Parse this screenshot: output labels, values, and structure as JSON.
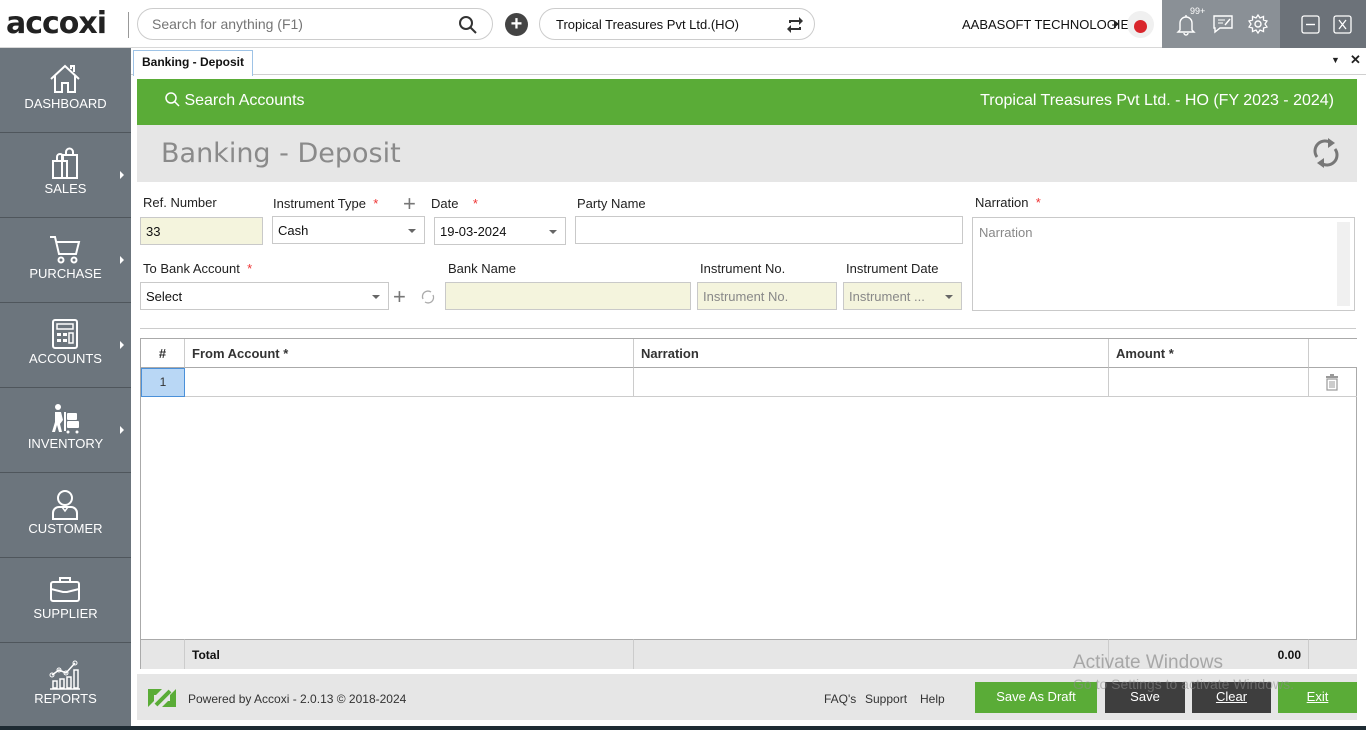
{
  "app": {
    "logo": "accoxi"
  },
  "topbar": {
    "search_placeholder": "Search for anything (F1)",
    "company_selector": "Tropical Treasures Pvt Ltd.(HO)",
    "organization": "AABASOFT TECHNOLOGIES",
    "notification_count": "99+"
  },
  "sidebar": {
    "items": [
      {
        "label": "DASHBOARD",
        "icon": "home-icon",
        "has_submenu": false
      },
      {
        "label": "SALES",
        "icon": "shopping-bag-icon",
        "has_submenu": true
      },
      {
        "label": "PURCHASE",
        "icon": "cart-icon",
        "has_submenu": true
      },
      {
        "label": "ACCOUNTS",
        "icon": "calculator-icon",
        "has_submenu": true
      },
      {
        "label": "INVENTORY",
        "icon": "trolley-icon",
        "has_submenu": true
      },
      {
        "label": "CUSTOMER",
        "icon": "user-icon",
        "has_submenu": false
      },
      {
        "label": "SUPPLIER",
        "icon": "briefcase-icon",
        "has_submenu": false
      },
      {
        "label": "REPORTS",
        "icon": "chart-icon",
        "has_submenu": false
      }
    ]
  },
  "tabs": [
    {
      "label": "Banking - Deposit",
      "active": true
    }
  ],
  "header": {
    "search_accounts": "Search Accounts",
    "company_fy": "Tropical Treasures Pvt Ltd. - HO (FY 2023 - 2024)",
    "page_title": "Banking - Deposit"
  },
  "form": {
    "ref_number": {
      "label": "Ref. Number",
      "value": "33"
    },
    "instrument_type": {
      "label": "Instrument Type",
      "required": "*",
      "value": "Cash"
    },
    "date": {
      "label": "Date",
      "required": "*",
      "value": "19-03-2024"
    },
    "party_name": {
      "label": "Party Name",
      "value": ""
    },
    "narration": {
      "label": "Narration",
      "required": "*",
      "placeholder": "Narration"
    },
    "to_bank_account": {
      "label": "To Bank Account",
      "required": "*",
      "value": "Select"
    },
    "bank_name": {
      "label": "Bank Name",
      "value": ""
    },
    "instrument_no": {
      "label": "Instrument No.",
      "placeholder": "Instrument No."
    },
    "instrument_date": {
      "label": "Instrument Date",
      "placeholder": "Instrument ..."
    }
  },
  "grid": {
    "columns": [
      "#",
      "From Account *",
      "Narration",
      "Amount *"
    ],
    "rows": [
      {
        "no": "1",
        "from_account": "",
        "narration": "",
        "amount": ""
      }
    ],
    "total_label": "Total",
    "total_amount": "0.00"
  },
  "footer": {
    "powered_by": "Powered by Accoxi - 2.0.13 © 2018-2024",
    "links": [
      "FAQ's",
      "Support",
      "Help"
    ],
    "buttons": {
      "save_draft": "Save As Draft",
      "save": "Save",
      "clear": "Clear",
      "exit": "Exit"
    }
  },
  "watermark": {
    "line1": "Activate Windows",
    "line2": "Go to Settings to activate Windows."
  },
  "colors": {
    "brand_green": "#5aac37",
    "sidebar": "#6c757d",
    "dark_button": "#3e3e3e"
  }
}
